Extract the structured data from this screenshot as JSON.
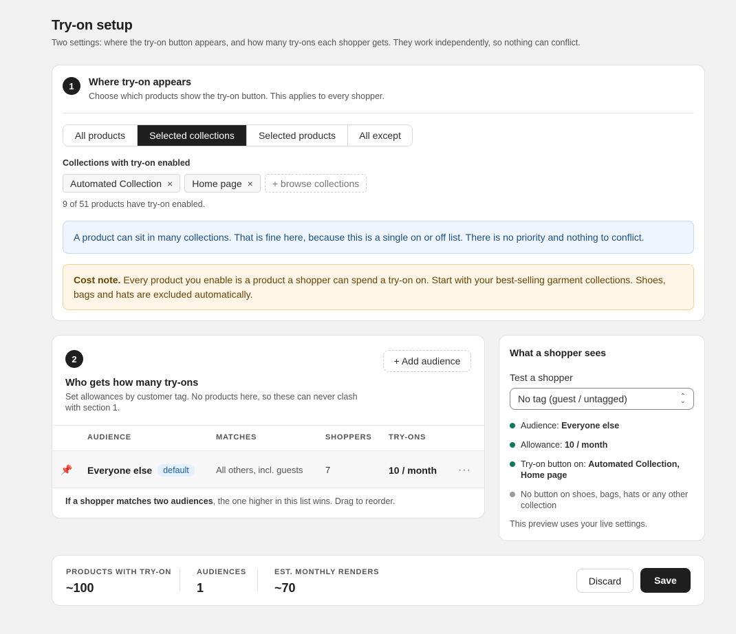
{
  "page": {
    "title": "Try-on setup",
    "subtitle": "Two settings: where the try-on button appears, and how many try-ons each shopper gets. They work independently, so nothing can conflict."
  },
  "section1": {
    "number": "1",
    "title": "Where try-on appears",
    "subtitle": "Choose which products show the try-on button. This applies to every shopper.",
    "tabs": [
      {
        "label": "All products",
        "active": false
      },
      {
        "label": "Selected collections",
        "active": true
      },
      {
        "label": "Selected products",
        "active": false
      },
      {
        "label": "All except",
        "active": false
      }
    ],
    "field_label": "Collections with try-on enabled",
    "chips": [
      "Automated Collection",
      "Home page"
    ],
    "chip_remove": "×",
    "browse_label": "+ browse collections",
    "count_text": "9 of 51 products have try-on enabled.",
    "info_banner": "A product can sit in many collections. That is fine here, because this is a single on or off list. There is no priority and nothing to conflict.",
    "warn_banner_strong": "Cost note.",
    "warn_banner_text": " Every product you enable is a product a shopper can spend a try-on on. Start with your best-selling garment collections. Shoes, bags and hats are excluded automatically."
  },
  "section2": {
    "number": "2",
    "title": "Who gets how many try-ons",
    "subtitle": "Set allowances by customer tag. No products here, so these can never clash with section 1.",
    "add_audience_label": "+ Add audience",
    "columns": {
      "audience": "AUDIENCE",
      "matches": "MATCHES",
      "shoppers": "SHOPPERS",
      "tryons": "TRY-ONS"
    },
    "rows": [
      {
        "pin": "📌",
        "audience": "Everyone else",
        "badge": "default",
        "matches": "All others, incl. guests",
        "shoppers": "7",
        "tryons": "10 / month",
        "more": "···"
      }
    ],
    "footer_strong": "If a shopper matches two audiences",
    "footer_text": ", the one higher in this list wins. Drag to reorder."
  },
  "preview": {
    "title": "What a shopper sees",
    "test_label": "Test a shopper",
    "select_value": "No tag (guest / untagged)",
    "items": [
      {
        "prefix": "Audience: ",
        "strong": "Everyone else",
        "on": true
      },
      {
        "prefix": "Allowance: ",
        "strong": "10 / month",
        "on": true
      },
      {
        "prefix": "Try-on button on: ",
        "strong": "Automated Collection, Home page",
        "on": true
      },
      {
        "prefix": "No button on shoes, bags, hats or any other collection",
        "strong": "",
        "on": false
      }
    ],
    "note": "This preview uses your live settings."
  },
  "summary": {
    "stats": [
      {
        "label": "PRODUCTS WITH TRY-ON",
        "value": "~100"
      },
      {
        "label": "AUDIENCES",
        "value": "1"
      },
      {
        "label": "EST. MONTHLY RENDERS",
        "value": "~70"
      }
    ],
    "discard_label": "Discard",
    "save_label": "Save"
  },
  "colors": {
    "primary": "#1f1f1f",
    "info_bg": "#eef5ff",
    "warn_bg": "#fff6e8",
    "status_on": "#0b7a5a",
    "status_off": "#9a9a9a"
  }
}
